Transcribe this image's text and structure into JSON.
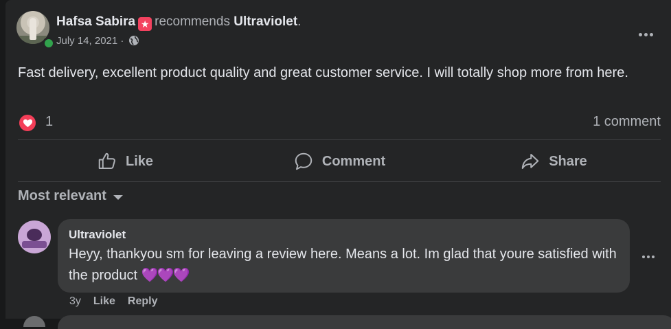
{
  "post": {
    "author": "Hafsa Sabira",
    "recommend_text": "recommends",
    "page_name": "Ultraviolet",
    "page_suffix": ".",
    "date": "July 14, 2021 ·",
    "body": "Fast delivery, excellent product quality and great customer service. I will totally shop more from here.",
    "reaction_count": "1",
    "comment_count": "1 comment"
  },
  "actions": {
    "like": "Like",
    "comment": "Comment",
    "share": "Share"
  },
  "comments_section": {
    "sort_label": "Most relevant"
  },
  "comment": {
    "author": "Ultraviolet",
    "text": "Heyy, thankyou sm for leaving a review here. Means a lot. Im glad that youre satisfied with the product",
    "emoji": "💜💜💜",
    "age": "3y",
    "like_label": "Like",
    "reply_label": "Reply"
  },
  "colors": {
    "background": "#18191a",
    "card": "#242526",
    "bubble": "#3a3b3c",
    "primary_text": "#e4e6eb",
    "secondary_text": "#b0b3b8",
    "love": "#f33e58",
    "online": "#31a24c"
  },
  "icons": {
    "recommend": "recommend-star-icon",
    "audience": "globe-icon",
    "reaction": "love-icon",
    "like": "thumbs-up-icon",
    "comment": "speech-bubble-icon",
    "share": "share-arrow-icon",
    "more": "more-dots-icon",
    "sort": "caret-down-icon"
  }
}
